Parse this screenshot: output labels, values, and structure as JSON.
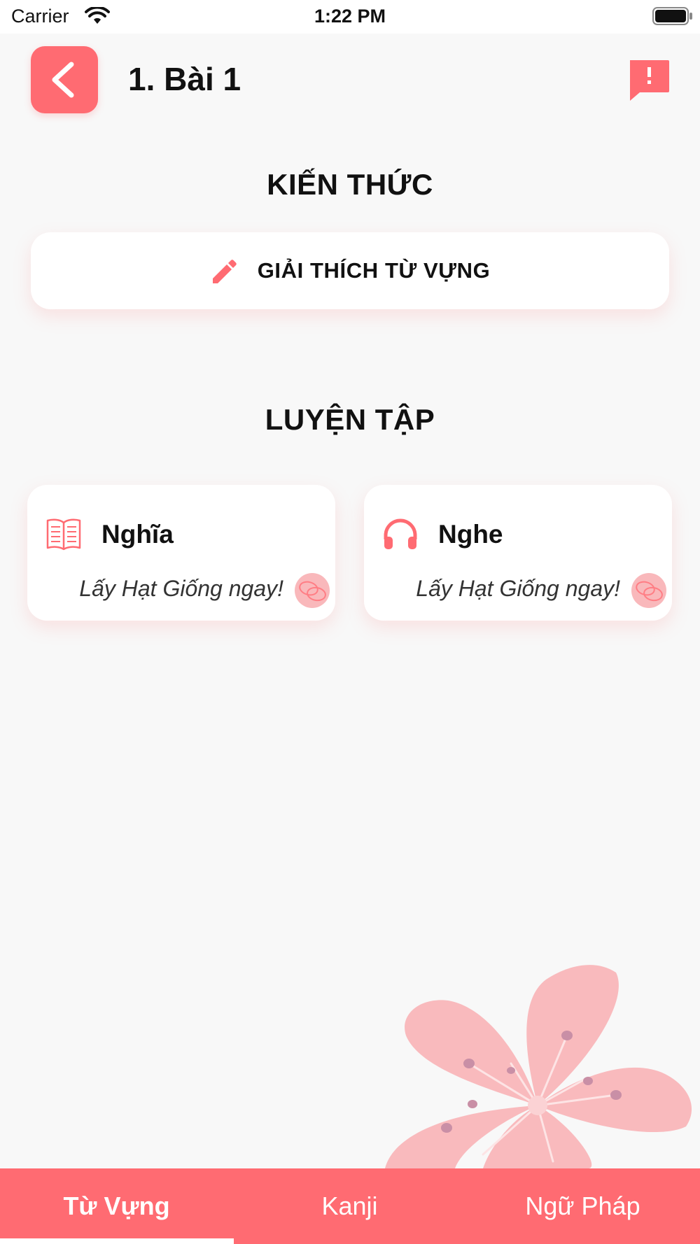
{
  "status_bar": {
    "carrier": "Carrier",
    "time": "1:22 PM"
  },
  "header": {
    "title": "1.  Bài 1",
    "back_icon": "chevron-left-icon",
    "report_icon": "report-message-icon"
  },
  "knowledge": {
    "title": "KIẾN THỨC",
    "explain_label": "GIẢI THÍCH TỪ VỰNG",
    "explain_icon": "pencil-icon"
  },
  "practice": {
    "title": "LUYỆN TẬP",
    "cards": [
      {
        "title": "Nghĩa",
        "subtitle": "Lấy Hạt Giống ngay!",
        "icon": "book-icon"
      },
      {
        "title": "Nghe",
        "subtitle": "Lấy Hạt Giống ngay!",
        "icon": "headphones-icon"
      }
    ]
  },
  "tabs": [
    {
      "label": "Từ Vựng",
      "active": true
    },
    {
      "label": "Kanji",
      "active": false
    },
    {
      "label": "Ngữ Pháp",
      "active": false
    }
  ],
  "colors": {
    "accent": "#ff6b72",
    "background": "#f8f8f8",
    "card": "#ffffff",
    "flower": "#f9b8bb"
  }
}
